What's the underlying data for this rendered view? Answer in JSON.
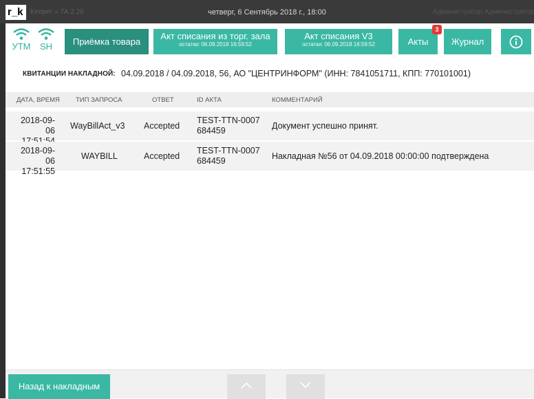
{
  "topbar": {
    "logo": "r_k",
    "version": "Keeper » 7А.2.26",
    "datetime": "четверг, 6 Сентябрь 2018 г., 18:00",
    "user": "Администратор Администратор"
  },
  "toolbar": {
    "utm_label": "УТМ",
    "sh_label": "SH",
    "btn_priemka": "Приёмка товара",
    "btn_akt_torg": "Акт списания из торг. зала",
    "btn_akt_torg_sub": "остатки: 06.09.2018 16:59:52",
    "btn_akt_v3": "Акт списания V3",
    "btn_akt_v3_sub": "остатки: 06.09.2018 16:59:52",
    "btn_akty": "Акты",
    "akty_badge": "3",
    "btn_journal": "Журнал"
  },
  "receipt": {
    "label": "КВИТАНЦИИ НАКЛАДНОЙ:",
    "value": "04.09.2018 / 04.09.2018, 56, АО \"ЦЕНТРИНФОРМ\" (ИНН: 7841051711, КПП: 770101001)"
  },
  "table": {
    "headers": {
      "date": "ДАТА, ВРЕМЯ",
      "type": "ТИП ЗАПРОСА",
      "answer": "ОТВЕТ",
      "id": "ID АКТА",
      "comment": "КОММЕНТАРИЙ"
    },
    "rows": [
      {
        "date": "2018-09-06",
        "time": "17:51:54",
        "type": "WayBillAct_v3",
        "answer": "Accepted",
        "id1": "TEST-TTN-0007",
        "id2": "684459",
        "comment": "Документ успешно принят."
      },
      {
        "date": "2018-09-06",
        "time": "17:51:55",
        "type": "WAYBILL",
        "answer": "Accepted",
        "id1": "TEST-TTN-0007",
        "id2": "684459",
        "comment": "Накладная №56 от 04.09.2018 00:00:00 подтверждена"
      }
    ]
  },
  "bottom": {
    "back_label": "Назад к накладным"
  },
  "colors": {
    "accent": "#3ab8a4",
    "accent_dark": "#2a8f7d",
    "badge": "#e53935"
  }
}
